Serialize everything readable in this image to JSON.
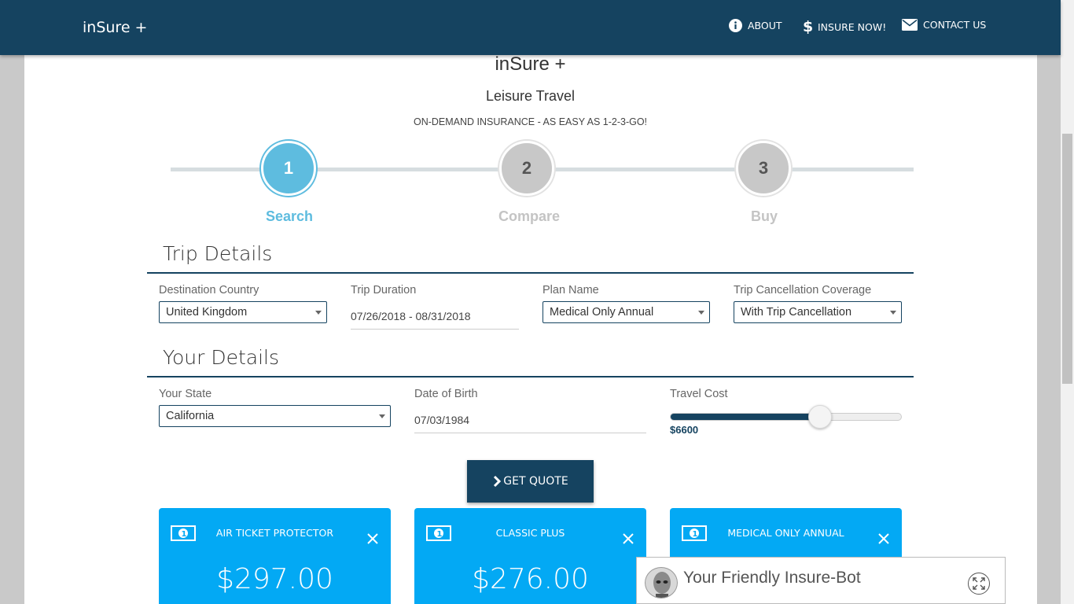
{
  "nav": {
    "brand": "inSure +",
    "about": "ABOUT",
    "insure_now": "INSURE NOW!",
    "contact": "CONTACT US"
  },
  "header": {
    "title": "inSure +",
    "subtitle": "Leisure Travel",
    "tagline": "ON-DEMAND INSURANCE - AS EASY AS 1-2-3-GO!"
  },
  "steps": [
    {
      "number": "1",
      "label": "Search"
    },
    {
      "number": "2",
      "label": "Compare"
    },
    {
      "number": "3",
      "label": "Buy"
    }
  ],
  "trip": {
    "section_title": "Trip Details",
    "destination_label": "Destination Country",
    "destination_value": "United Kingdom",
    "duration_label": "Trip Duration",
    "duration_value": "07/26/2018 - 08/31/2018",
    "plan_label": "Plan Name",
    "plan_value": "Medical Only Annual",
    "cancel_label": "Trip Cancellation Coverage",
    "cancel_value": "With Trip Cancellation"
  },
  "you": {
    "section_title": "Your Details",
    "state_label": "Your State",
    "state_value": "California",
    "dob_label": "Date of Birth",
    "dob_value": "07/03/1984",
    "cost_label": "Travel Cost",
    "cost_value": "$6600",
    "cost_fraction": 0.64
  },
  "quote_button": "GET QUOTE",
  "plans": [
    {
      "name": "AIR TICKET PROTECTOR",
      "price": "$297.00"
    },
    {
      "name": "CLASSIC PLUS",
      "price": "$276.00"
    },
    {
      "name": "MEDICAL ONLY ANNUAL",
      "price": ""
    }
  ],
  "chatbot": {
    "title": "Your Friendly Insure-Bot"
  },
  "colors": {
    "navbar": "#154360",
    "accent": "#5ebcdf",
    "card": "#03a9f4"
  }
}
